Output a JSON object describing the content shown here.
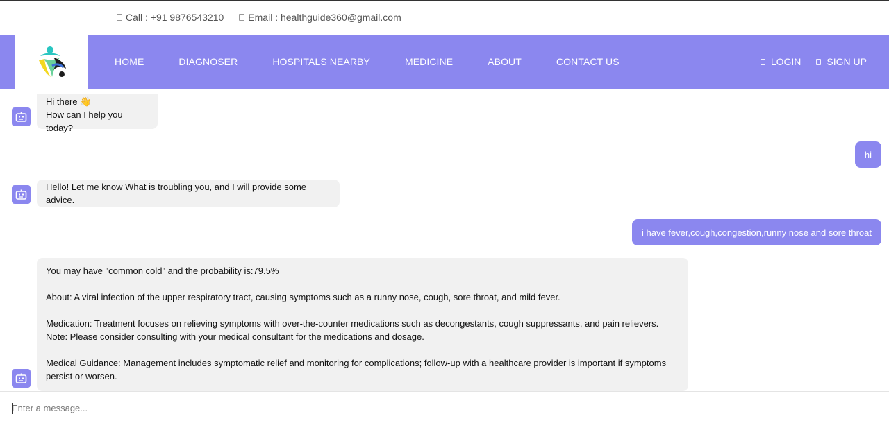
{
  "topbar": {
    "call": "Call : +91 9876543210",
    "email": "Email : healthguide360@gmail.com"
  },
  "nav": {
    "links": [
      "HOME",
      "DIAGNOSER",
      "HOSPITALS NEARBY",
      "MEDICINE",
      "ABOUT",
      "CONTACT US"
    ],
    "login": "LOGIN",
    "signup": "SIGN UP"
  },
  "colors": {
    "accent": "#8b87ef",
    "bot_bubble": "#f1f1f1"
  },
  "chat": {
    "greeting_line1": "Hi there 👋",
    "greeting_line2": "How can I help you today?",
    "user_msg_1": "hi",
    "bot_msg_1": "Hello! Let me know What is troubling you, and I will provide some advice.",
    "user_msg_2": "i have fever,cough,congestion,runny nose and sore throat",
    "bot_result": {
      "diagnosis": "You may have \"common cold\" and the probability is:79.5%",
      "about": "About: A viral infection of the upper respiratory tract, causing symptoms such as a runny nose, cough, sore throat, and mild fever.",
      "medication": "Medication: Treatment focuses on relieving symptoms with over-the-counter medications such as decongestants, cough suppressants, and pain relievers.",
      "note": "Note: Please consider consulting with your medical consultant for the medications and dosage.",
      "guidance": "Medical Guidance: Management includes symptomatic relief and monitoring for complications; follow-up with a healthcare provider is important if symptoms persist or worsen."
    }
  },
  "composer": {
    "placeholder": "Enter a message..."
  }
}
